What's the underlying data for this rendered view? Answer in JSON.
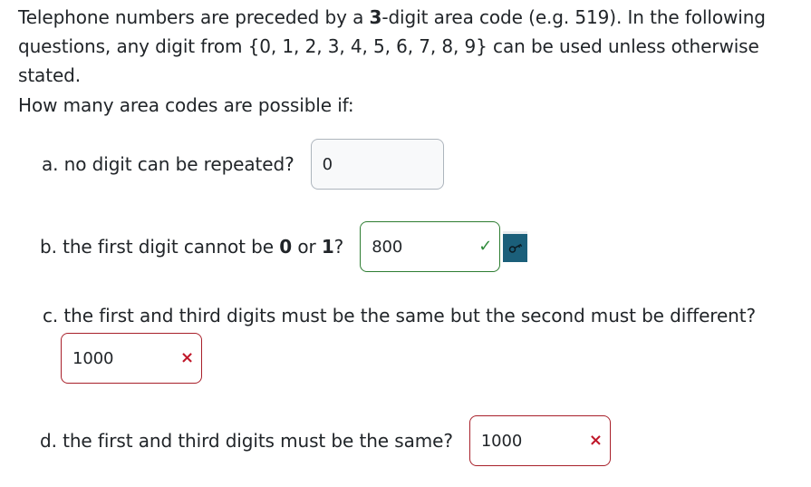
{
  "intro": {
    "part1": "Telephone numbers are preceded by a ",
    "bold": "3",
    "part2": "-digit area code (e.g. 519). In the following questions, any digit from {0, 1, 2, 3, 4, 5, 6, 7, 8, 9} can be used unless otherwise stated."
  },
  "question_heading": "How many area codes are possible if:",
  "questions": [
    {
      "label": "a. no digit can be repeated?",
      "answer": "0"
    },
    {
      "label_part1": "b. the first digit cannot be ",
      "bold1": "0",
      "label_part2": " or ",
      "bold2": "1",
      "label_part3": "?",
      "answer": "800",
      "status_mark": "✓"
    },
    {
      "label": "c. the first and third digits must be the same but the second must be different?",
      "answer": "1000",
      "status_mark": "×"
    },
    {
      "label": "d. the first and third digits must be the same?",
      "answer": "1000",
      "status_mark": "×"
    }
  ],
  "colors": {
    "correct": "#2e7d32",
    "incorrect": "#a8202a",
    "key_button": "#1b5f7a"
  },
  "icons": {
    "correct": "check-icon",
    "incorrect": "cross-icon",
    "key": "key-icon"
  }
}
